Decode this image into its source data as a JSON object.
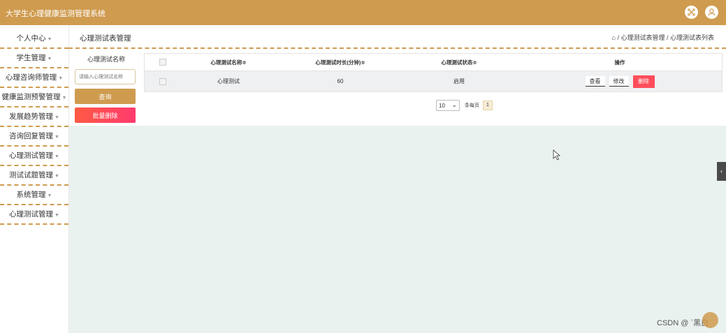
{
  "app": {
    "title": "大学生心理健康监测管理系统"
  },
  "topbar": {
    "fullscreen_icon": "expand-icon",
    "user_icon": "user-icon"
  },
  "sidebar": {
    "items": [
      {
        "label": "个人中心"
      },
      {
        "label": "学生管理"
      },
      {
        "label": "心理咨询师管理"
      },
      {
        "label": "健康监测预警管理"
      },
      {
        "label": "发展趋势管理"
      },
      {
        "label": "咨询回复管理"
      },
      {
        "label": "心理测试管理"
      },
      {
        "label": "测试试题管理"
      },
      {
        "label": "系统管理"
      },
      {
        "label": "心理测试管理"
      }
    ]
  },
  "header": {
    "title": "心理测试表管理",
    "breadcrumb": "⌂ / 心理测试表管理 / 心理测试表列表"
  },
  "filter": {
    "label": "心理测试名称",
    "placeholder": "请输入心理测试名称",
    "query_button": "查询",
    "batch_delete_button": "批量删除"
  },
  "table": {
    "columns": [
      "心理测试名称≑",
      "心理测试时长(分钟)≑",
      "心理测试状态≑",
      "操作"
    ],
    "rows": [
      {
        "name": "心理测试",
        "duration": "60",
        "status": "启用"
      }
    ],
    "actions": {
      "view": "查看",
      "edit": "修改",
      "delete": "删除"
    }
  },
  "pagination": {
    "page_size": "10",
    "per_page_text": "条每页",
    "current_page": "1"
  },
  "watermark": "CSDN @ `黑白",
  "colors": {
    "brand": "#cf9b4f",
    "danger": "#ff4d5a",
    "content_bg": "#e9f2ee"
  }
}
